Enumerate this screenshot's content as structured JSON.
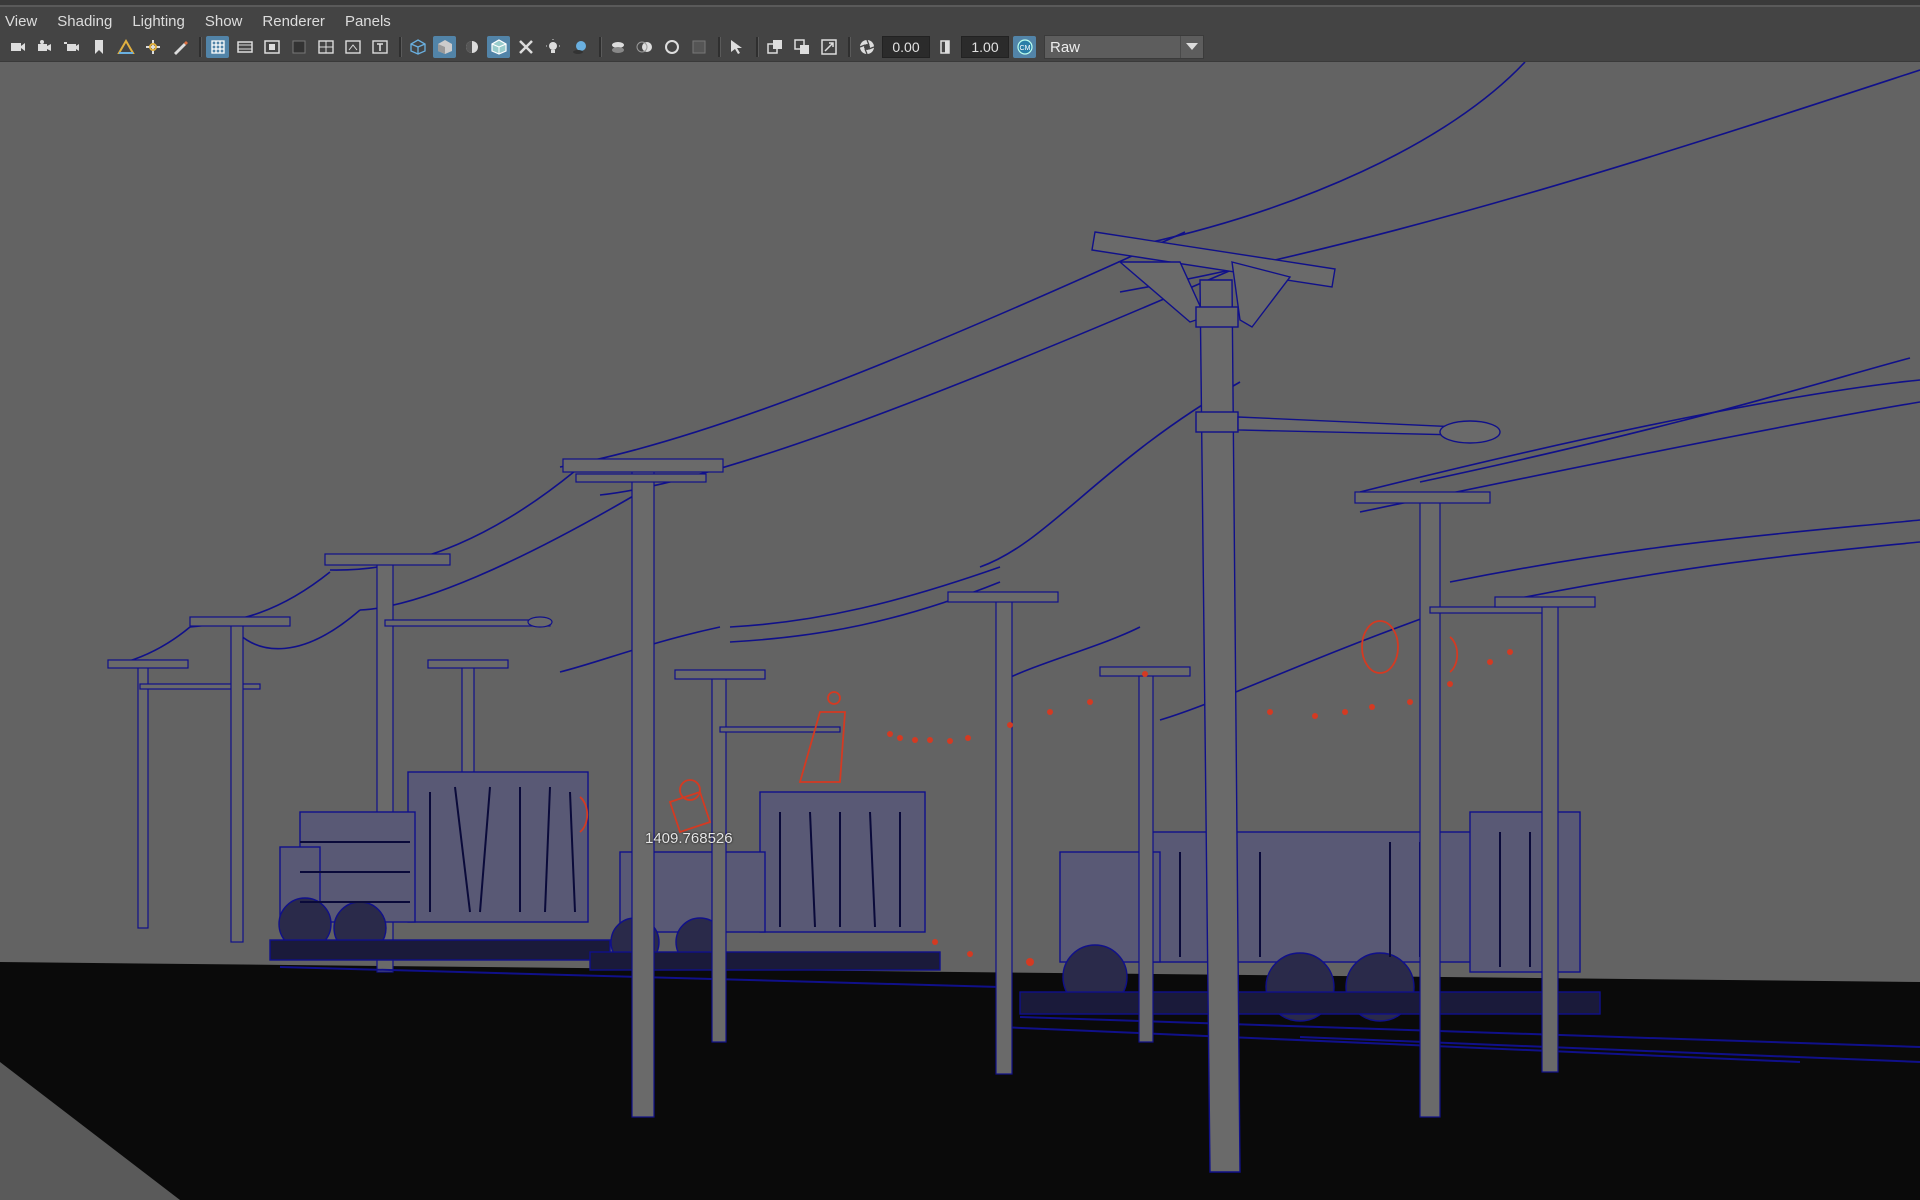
{
  "menu": {
    "items": [
      "View",
      "Shading",
      "Lighting",
      "Show",
      "Renderer",
      "Panels"
    ]
  },
  "toolbar": {
    "icons": [
      "camera-select-icon",
      "camera-attributes-icon",
      "camera-bookmark-icon",
      "bookmark-icon",
      "image-plane-icon",
      "2d-pan-zoom-icon",
      "grease-pencil-icon",
      "grid-icon",
      "film-gate-icon",
      "resolution-gate-icon",
      "gate-mask-icon",
      "field-chart-icon",
      "safe-action-icon",
      "safe-title-icon",
      "wireframe-icon",
      "smooth-shade-icon",
      "use-default-material-icon",
      "wireframe-on-shaded-icon",
      "xray-icon",
      "default-lighting-icon",
      "shadows-icon",
      "screen-space-ao-icon",
      "motion-blur-icon",
      "multisample-aa-icon",
      "depth-of-field-icon",
      "isolate-select-icon",
      "xray-joints-icon",
      "xray-active-components-icon",
      "toggle-hud-icon",
      "exposure-icon",
      "gamma-icon",
      "color-management-icon"
    ],
    "exposure_value": "0.00",
    "gamma_value": "1.00",
    "view_transform": "Raw"
  },
  "viewport": {
    "hud_readout": "1409.768526"
  },
  "colors": {
    "wireframe": "#10108a",
    "selection_red": "#d43a22",
    "ground": "#0a0a0a",
    "background": "#636363",
    "active_button": "#5284a8"
  }
}
